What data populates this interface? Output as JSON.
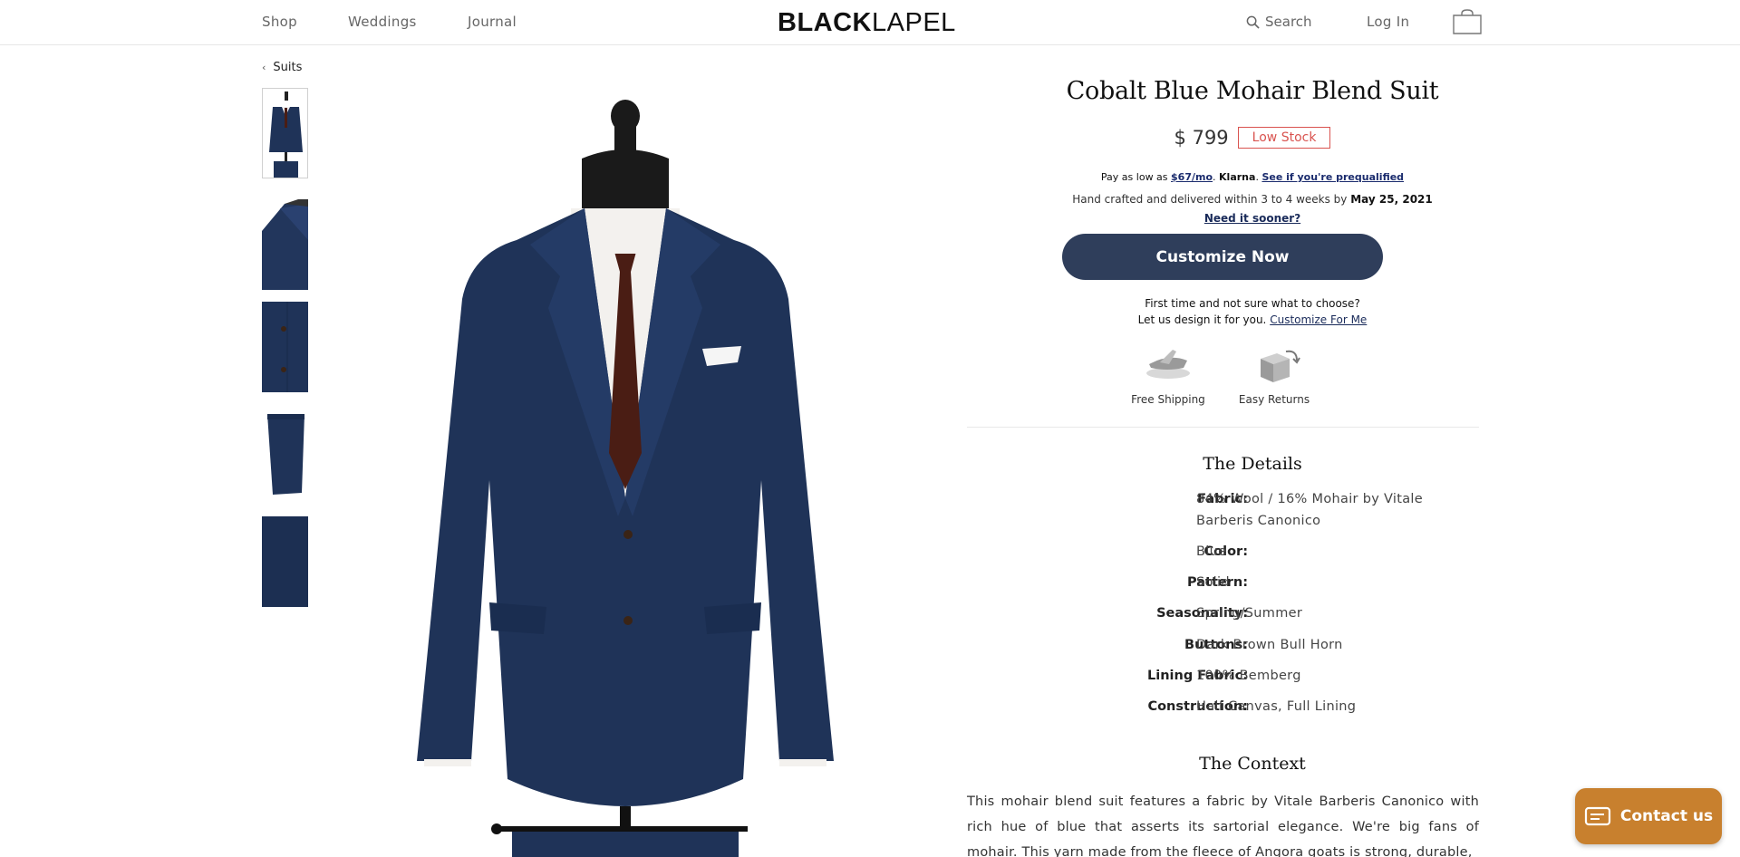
{
  "nav": {
    "shop": "Shop",
    "weddings": "Weddings",
    "journal": "Journal",
    "logo_bold": "BLACK",
    "logo_light": "LAPEL",
    "search": "Search",
    "login": "Log In"
  },
  "breadcrumb": {
    "label": "Suits"
  },
  "product": {
    "title": "Cobalt Blue Mohair Blend Suit",
    "price": "$ 799",
    "stock_badge": "Low Stock",
    "klarna": {
      "prefix": "Pay as low as",
      "monthly": "$67/mo",
      "brand": "Klarna",
      "link": "See if you're prequalified"
    },
    "delivery_text": "Hand crafted and delivered within 3 to 4 weeks by",
    "delivery_date": "May 25, 2021",
    "need_sooner": "Need it sooner?",
    "cta": "Customize Now",
    "first_time": "First time and not sure what to choose?",
    "design_for_you": "Let us design it for you.",
    "customize_for_me": "Customize For Me",
    "perks": {
      "shipping": "Free Shipping",
      "returns": "Easy Returns"
    }
  },
  "details": {
    "heading": "The Details",
    "rows": [
      {
        "key": "Fabric:",
        "value": "84% Wool / 16% Mohair by Vitale Barberis Canonico"
      },
      {
        "key": "Color:",
        "value": "Blue"
      },
      {
        "key": "Pattern:",
        "value": "Solid"
      },
      {
        "key": "Seasonality:",
        "value": "Spring/Summer"
      },
      {
        "key": "Buttons:",
        "value": "Dark Brown Bull Horn"
      },
      {
        "key": "Lining Fabric:",
        "value": "100% Bemberg"
      },
      {
        "key": "Construction:",
        "value": "Half Canvas, Full Lining"
      }
    ]
  },
  "context": {
    "heading": "The Context",
    "text": "This mohair blend suit features a fabric by Vitale Barberis Canonico with rich hue of blue that asserts its sartorial elegance. We're big fans of mohair. This yarn made from the fleece of Angora goats is strong, durable,"
  },
  "contact": {
    "label": "Contact us"
  },
  "colors": {
    "accent": "#2f3e5b",
    "low_stock": "#d9534f",
    "contact": "#c8802e",
    "suit": "#1f3358"
  }
}
